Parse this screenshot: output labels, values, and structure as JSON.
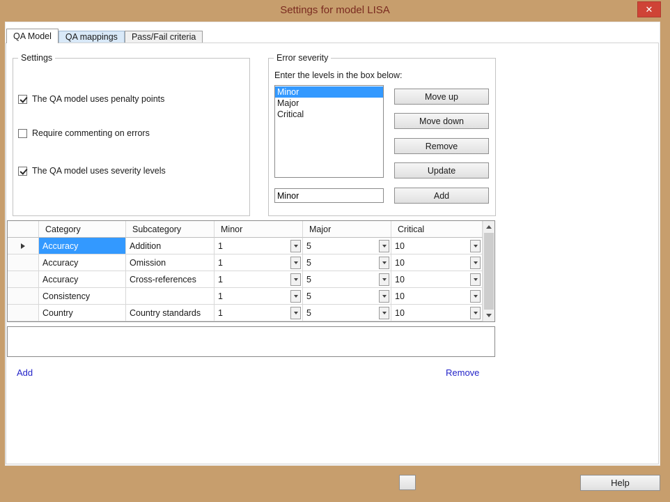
{
  "window": {
    "title": "Settings for model LISA"
  },
  "icons": {
    "close": "✕"
  },
  "tabs": [
    {
      "label": "QA Model",
      "active": true
    },
    {
      "label": "QA mappings",
      "active": false
    },
    {
      "label": "Pass/Fail criteria",
      "active": false
    }
  ],
  "settings": {
    "title": "Settings",
    "checkboxes": [
      {
        "label": "The QA model uses penalty points",
        "checked": true
      },
      {
        "label": "Require commenting on errors",
        "checked": false
      },
      {
        "label": "The QA model uses severity levels",
        "checked": true
      }
    ]
  },
  "error_severity": {
    "title": "Error severity",
    "instruction": "Enter the levels in the box below:",
    "levels": [
      "Minor",
      "Major",
      "Critical"
    ],
    "selected_level": "Minor",
    "input_value": "Minor",
    "buttons": {
      "move_up": "Move up",
      "move_down": "Move down",
      "remove": "Remove",
      "update": "Update",
      "add": "Add"
    }
  },
  "grid": {
    "columns": [
      "Category",
      "Subcategory",
      "Minor",
      "Major",
      "Critical"
    ],
    "rows": [
      {
        "category": "Accuracy",
        "subcategory": "Addition",
        "minor": "1",
        "major": "5",
        "critical": "10",
        "selected": true
      },
      {
        "category": "Accuracy",
        "subcategory": "Omission",
        "minor": "1",
        "major": "5",
        "critical": "10",
        "selected": false
      },
      {
        "category": "Accuracy",
        "subcategory": "Cross-references",
        "minor": "1",
        "major": "5",
        "critical": "10",
        "selected": false
      },
      {
        "category": "Consistency",
        "subcategory": "",
        "minor": "1",
        "major": "5",
        "critical": "10",
        "selected": false
      },
      {
        "category": "Country",
        "subcategory": "Country standards",
        "minor": "1",
        "major": "5",
        "critical": "10",
        "selected": false
      }
    ]
  },
  "new_category_input": {
    "value": ""
  },
  "category_links": {
    "add": "Add",
    "remove": "Remove"
  },
  "footer": {
    "help": "Help"
  },
  "colors": {
    "frame": "#c79e6d",
    "title-text": "#7a2b20",
    "close-button": "#cf4336",
    "selection": "#3399ff",
    "link": "#2323c8"
  }
}
